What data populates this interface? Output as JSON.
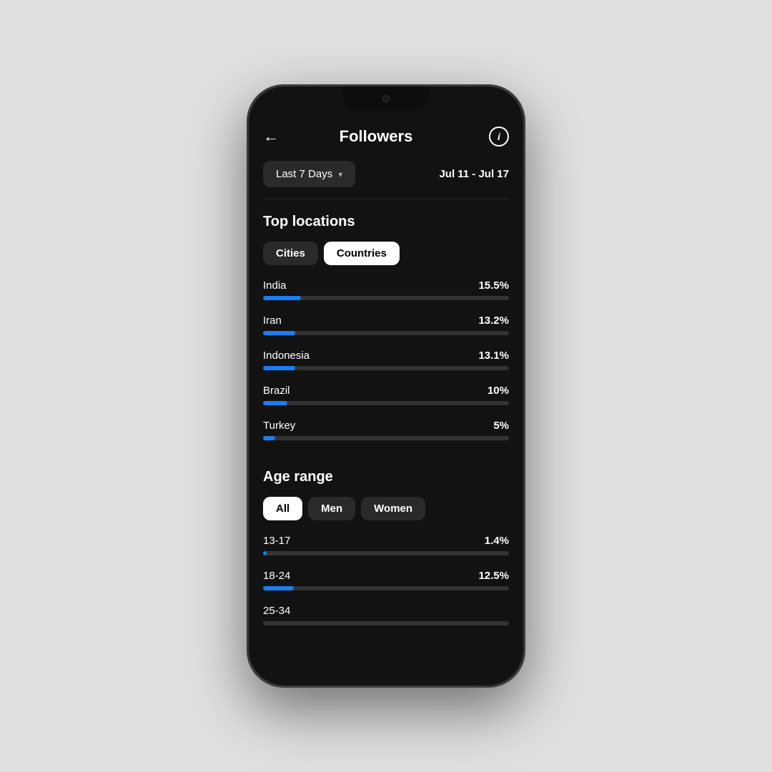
{
  "header": {
    "title": "Followers",
    "back_label": "←",
    "info_label": "i"
  },
  "filter": {
    "date_range_label": "Last 7 Days",
    "chevron": "▾",
    "date_range": "Jul 11 - Jul 17"
  },
  "top_locations": {
    "title": "Top locations",
    "tabs": [
      {
        "label": "Cities",
        "active": false
      },
      {
        "label": "Countries",
        "active": true
      }
    ],
    "countries": [
      {
        "name": "India",
        "pct": "15.5%",
        "fill": 15.5
      },
      {
        "name": "Iran",
        "pct": "13.2%",
        "fill": 13.2
      },
      {
        "name": "Indonesia",
        "pct": "13.1%",
        "fill": 13.1
      },
      {
        "name": "Brazil",
        "pct": "10%",
        "fill": 10
      },
      {
        "name": "Turkey",
        "pct": "5%",
        "fill": 5
      }
    ]
  },
  "age_range": {
    "title": "Age range",
    "tabs": [
      {
        "label": "All",
        "active": true
      },
      {
        "label": "Men",
        "active": false
      },
      {
        "label": "Women",
        "active": false
      }
    ],
    "ranges": [
      {
        "name": "13-17",
        "pct": "1.4%",
        "fill": 1.4
      },
      {
        "name": "18-24",
        "pct": "12.5%",
        "fill": 12.5
      },
      {
        "name": "25-34",
        "pct": "...",
        "fill": 0
      }
    ]
  }
}
